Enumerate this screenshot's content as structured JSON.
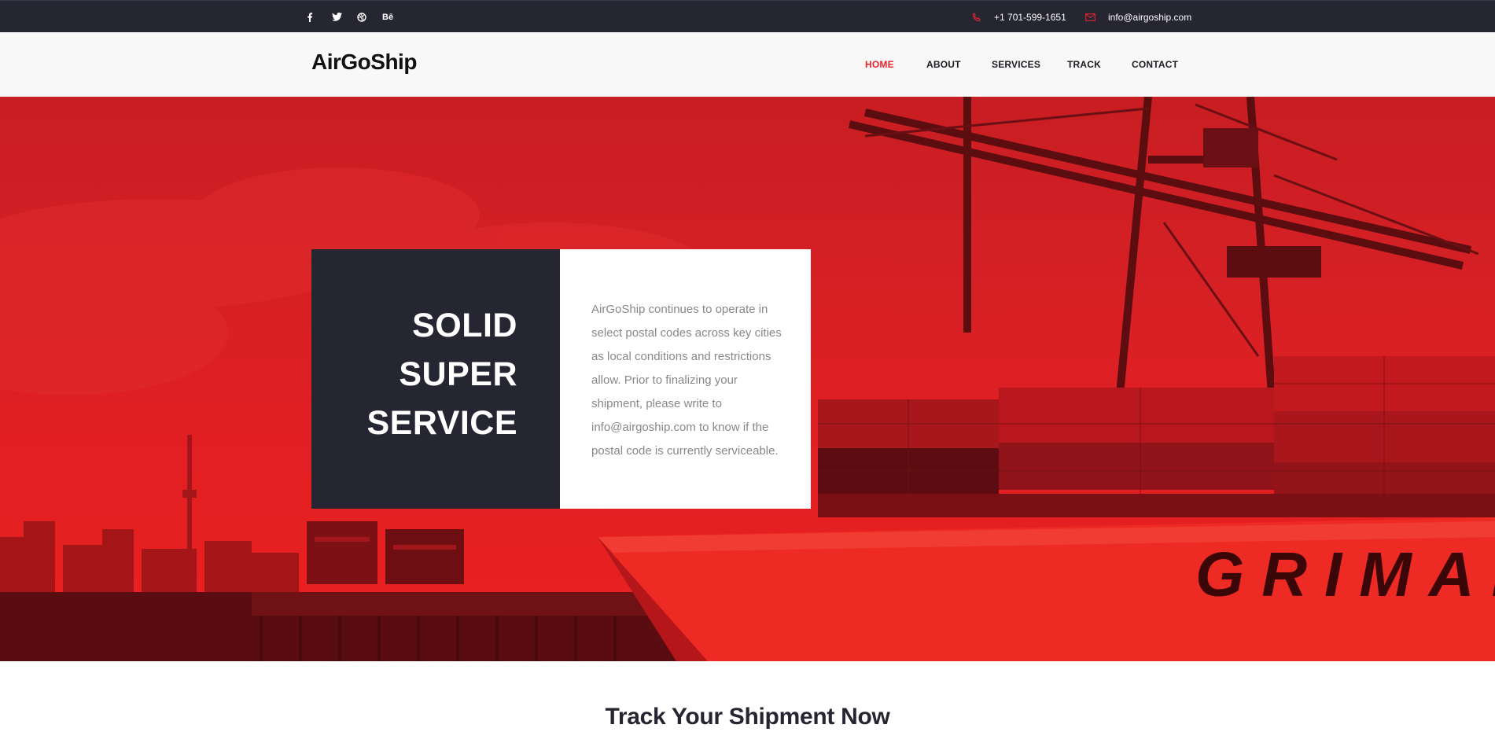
{
  "topbar": {
    "social_icons": [
      "facebook-icon",
      "twitter-icon",
      "dribbble-icon",
      "behance-icon"
    ],
    "behance_label": "Bē",
    "phone": "+1 701-599-1651",
    "email": "info@airgoship.com",
    "phone_icon": "phone-icon",
    "email_icon": "envelope-icon"
  },
  "header": {
    "logo": "AirGoShip",
    "nav": [
      {
        "label": "HOME",
        "active": true
      },
      {
        "label": "ABOUT",
        "active": false
      },
      {
        "label": "SERVICES",
        "active": false
      },
      {
        "label": "TRACK",
        "active": false
      },
      {
        "label": "CONTACT",
        "active": false
      }
    ]
  },
  "hero": {
    "title_lines": [
      "SOLID",
      "SUPER",
      "SERVICE"
    ],
    "text": "AirGoShip continues to operate in select postal codes across key cities as local conditions and restrictions allow. Prior to finalizing your shipment, please write to info@airgoship.com to know if the postal code is currently serviceable.",
    "ship_lettering": "GRIMAL"
  },
  "section": {
    "title": "Track Your Shipment Now"
  },
  "colors": {
    "accent": "#e8232d",
    "dark": "#262633",
    "header_bg": "#f8f8f8"
  }
}
